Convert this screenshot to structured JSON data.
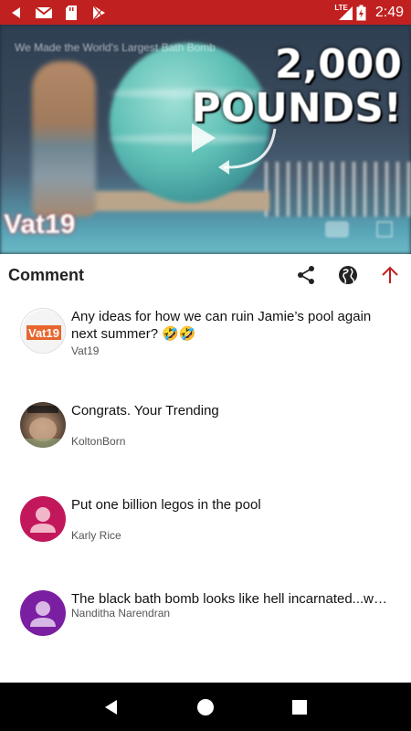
{
  "status_bar": {
    "time": "2:49",
    "network": "LTE",
    "background": "#c0201f",
    "icons": [
      "back-icon",
      "gmail-icon",
      "sd-card-icon",
      "play-store-icon",
      "signal-icon",
      "battery-icon"
    ]
  },
  "video": {
    "title": "We Made the World's Largest Bath Bomb",
    "overlay_text_line1": "2,000",
    "overlay_text_line2": "POUNDS!",
    "logo": "Vat19"
  },
  "header": {
    "title": "Comment",
    "accent": "#c0201f"
  },
  "comments": [
    {
      "text": "Any ideas for how we can ruin Jamie’s pool again next summer? 🤣🤣",
      "author": "Vat19",
      "avatar": "vat19-logo"
    },
    {
      "text": "Congrats. Your Trending",
      "author": "KoltonBorn",
      "avatar": "photo"
    },
    {
      "text": "Put one billion legos in the pool",
      "author": "Karly Rice",
      "avatar": "default",
      "avatar_color": "#c2185b"
    },
    {
      "text": "The black bath bomb looks like hell incarnated...why would anyone want to swim in that",
      "author": "Nanditha Narendran",
      "avatar": "default",
      "avatar_color": "#7b1fa2"
    }
  ],
  "nav_bar": {
    "icons": [
      "back-triangle-icon",
      "home-circle-icon",
      "recents-square-icon"
    ]
  }
}
